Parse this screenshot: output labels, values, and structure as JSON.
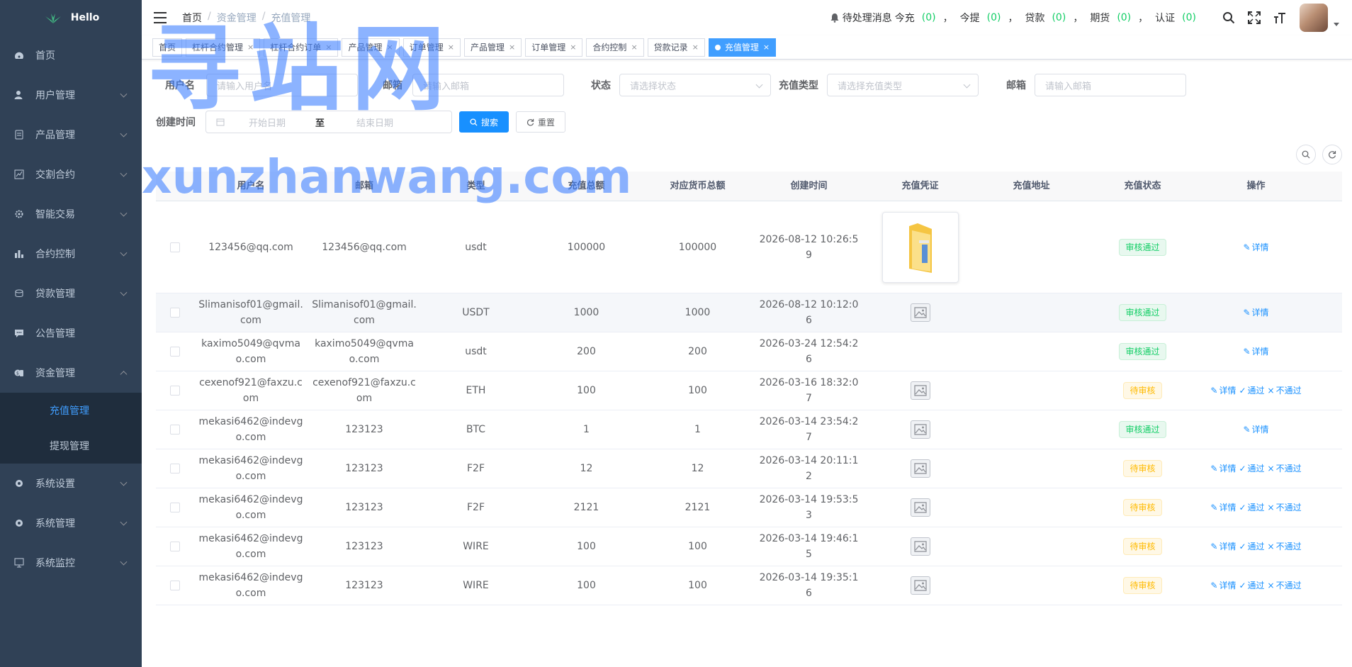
{
  "app": {
    "logo_text": "Hello"
  },
  "sidebar": {
    "items": [
      {
        "label": "首页",
        "icon": "dashboard-icon",
        "has_children": false
      },
      {
        "label": "用户管理",
        "icon": "user-icon",
        "has_children": true
      },
      {
        "label": "产品管理",
        "icon": "document-icon",
        "has_children": true
      },
      {
        "label": "交割合约",
        "icon": "chart-line-icon",
        "has_children": true
      },
      {
        "label": "智能交易",
        "icon": "gear-icon",
        "has_children": true
      },
      {
        "label": "合约控制",
        "icon": "bar-chart-icon",
        "has_children": true
      },
      {
        "label": "贷款管理",
        "icon": "coins-icon",
        "has_children": true
      },
      {
        "label": "公告管理",
        "icon": "message-icon",
        "has_children": false
      },
      {
        "label": "资金管理",
        "icon": "money-icon",
        "has_children": true,
        "expanded": true
      }
    ],
    "subitems": [
      {
        "label": "充值管理",
        "active": true
      },
      {
        "label": "提现管理",
        "active": false
      }
    ],
    "items_after": [
      {
        "label": "系统设置",
        "icon": "settings-icon",
        "has_children": true
      },
      {
        "label": "系统管理",
        "icon": "system-icon",
        "has_children": true
      },
      {
        "label": "系统监控",
        "icon": "monitor-icon",
        "has_children": true
      }
    ]
  },
  "breadcrumb": [
    "首页",
    "资金管理",
    "充值管理"
  ],
  "notice": {
    "prefix": "待处理消息",
    "items": [
      {
        "label": "今充",
        "count": "(0)"
      },
      {
        "label": "今提",
        "count": "(0)"
      },
      {
        "label": "贷款",
        "count": "(0)"
      },
      {
        "label": "期货",
        "count": "(0)"
      },
      {
        "label": "认证",
        "count": "(0)"
      }
    ],
    "separator": "，"
  },
  "tags": [
    {
      "label": "首页",
      "closable": false,
      "active": false
    },
    {
      "label": "杠杆合约管理",
      "closable": true,
      "active": false
    },
    {
      "label": "杠杆合约订单",
      "closable": true,
      "active": false
    },
    {
      "label": "产品管理",
      "closable": true,
      "active": false
    },
    {
      "label": "订单管理",
      "closable": true,
      "active": false
    },
    {
      "label": "产品管理",
      "closable": true,
      "active": false
    },
    {
      "label": "订单管理",
      "closable": true,
      "active": false
    },
    {
      "label": "合约控制",
      "closable": true,
      "active": false
    },
    {
      "label": "贷款记录",
      "closable": true,
      "active": false
    },
    {
      "label": "充值管理",
      "closable": true,
      "active": true
    }
  ],
  "form": {
    "username_label": "用户名",
    "username_placeholder": "请输入用户名",
    "email_label": "邮箱",
    "email_placeholder": "请输入邮箱",
    "status_label": "状态",
    "status_placeholder": "请选择状态",
    "recharge_type_label": "充值类型",
    "recharge_type_placeholder": "请选择充值类型",
    "email2_label": "邮箱",
    "email2_placeholder": "请输入邮箱",
    "created_label": "创建时间",
    "start_placeholder": "开始日期",
    "to_label": "至",
    "end_placeholder": "结束日期",
    "search_label": "搜索",
    "reset_label": "重置"
  },
  "table": {
    "headers": [
      "用户名",
      "邮箱",
      "类型",
      "充值总额",
      "对应货币总额",
      "创建时间",
      "充值凭证",
      "充值地址",
      "充值状态",
      "操作"
    ],
    "op_labels": {
      "detail": "详情",
      "approve": "通过",
      "reject": "不通过"
    },
    "rows": [
      {
        "user": "123456@qq.com",
        "email": "123456@qq.com",
        "type": "usdt",
        "amount": "100000",
        "currency_amount": "100000",
        "created": "2026-08-12 10:26:59",
        "proof": "folder-image",
        "address": "",
        "status": "审核通过",
        "status_kind": "ok"
      },
      {
        "user": "Slimanisof01@gmail.com",
        "email": "Slimanisof01@gmail.com",
        "type": "USDT",
        "amount": "1000",
        "currency_amount": "1000",
        "created": "2026-08-12 10:12:06",
        "proof": "image-placeholder",
        "address": "",
        "status": "审核通过",
        "status_kind": "ok"
      },
      {
        "user": "kaximo5049@qvmao.com",
        "email": "kaximo5049@qvmao.com",
        "type": "usdt",
        "amount": "200",
        "currency_amount": "200",
        "created": "2026-03-24 12:54:26",
        "proof": "none",
        "address": "",
        "status": "审核通过",
        "status_kind": "ok"
      },
      {
        "user": "cexenof921@faxzu.com",
        "email": "cexenof921@faxzu.com",
        "type": "ETH",
        "amount": "100",
        "currency_amount": "100",
        "created": "2026-03-16 18:32:07",
        "proof": "image-placeholder",
        "address": "",
        "status": "待审核",
        "status_kind": "pending"
      },
      {
        "user": "mekasi6462@indevgo.com",
        "email": "123123",
        "type": "BTC",
        "amount": "1",
        "currency_amount": "1",
        "created": "2026-03-14 23:54:27",
        "proof": "image-placeholder",
        "address": "",
        "status": "审核通过",
        "status_kind": "ok"
      },
      {
        "user": "mekasi6462@indevgo.com",
        "email": "123123",
        "type": "F2F",
        "amount": "12",
        "currency_amount": "12",
        "created": "2026-03-14 20:11:12",
        "proof": "image-placeholder",
        "address": "",
        "status": "待审核",
        "status_kind": "pending"
      },
      {
        "user": "mekasi6462@indevgo.com",
        "email": "123123",
        "type": "F2F",
        "amount": "2121",
        "currency_amount": "2121",
        "created": "2026-03-14 19:53:53",
        "proof": "image-placeholder",
        "address": "",
        "status": "待审核",
        "status_kind": "pending"
      },
      {
        "user": "mekasi6462@indevgo.com",
        "email": "123123",
        "type": "WIRE",
        "amount": "100",
        "currency_amount": "100",
        "created": "2026-03-14 19:46:15",
        "proof": "image-placeholder",
        "address": "",
        "status": "待审核",
        "status_kind": "pending"
      },
      {
        "user": "mekasi6462@indevgo.com",
        "email": "123123",
        "type": "WIRE",
        "amount": "100",
        "currency_amount": "100",
        "created": "2026-03-14 19:35:16",
        "proof": "image-placeholder",
        "address": "",
        "status": "待审核",
        "status_kind": "pending"
      }
    ]
  },
  "watermark": {
    "cn": "寻站网",
    "en": "xunzhanwang.com"
  },
  "colors": {
    "sidebar_bg": "#304156",
    "primary": "#1890ff",
    "success": "#13ce66",
    "warning": "#ffba00"
  }
}
